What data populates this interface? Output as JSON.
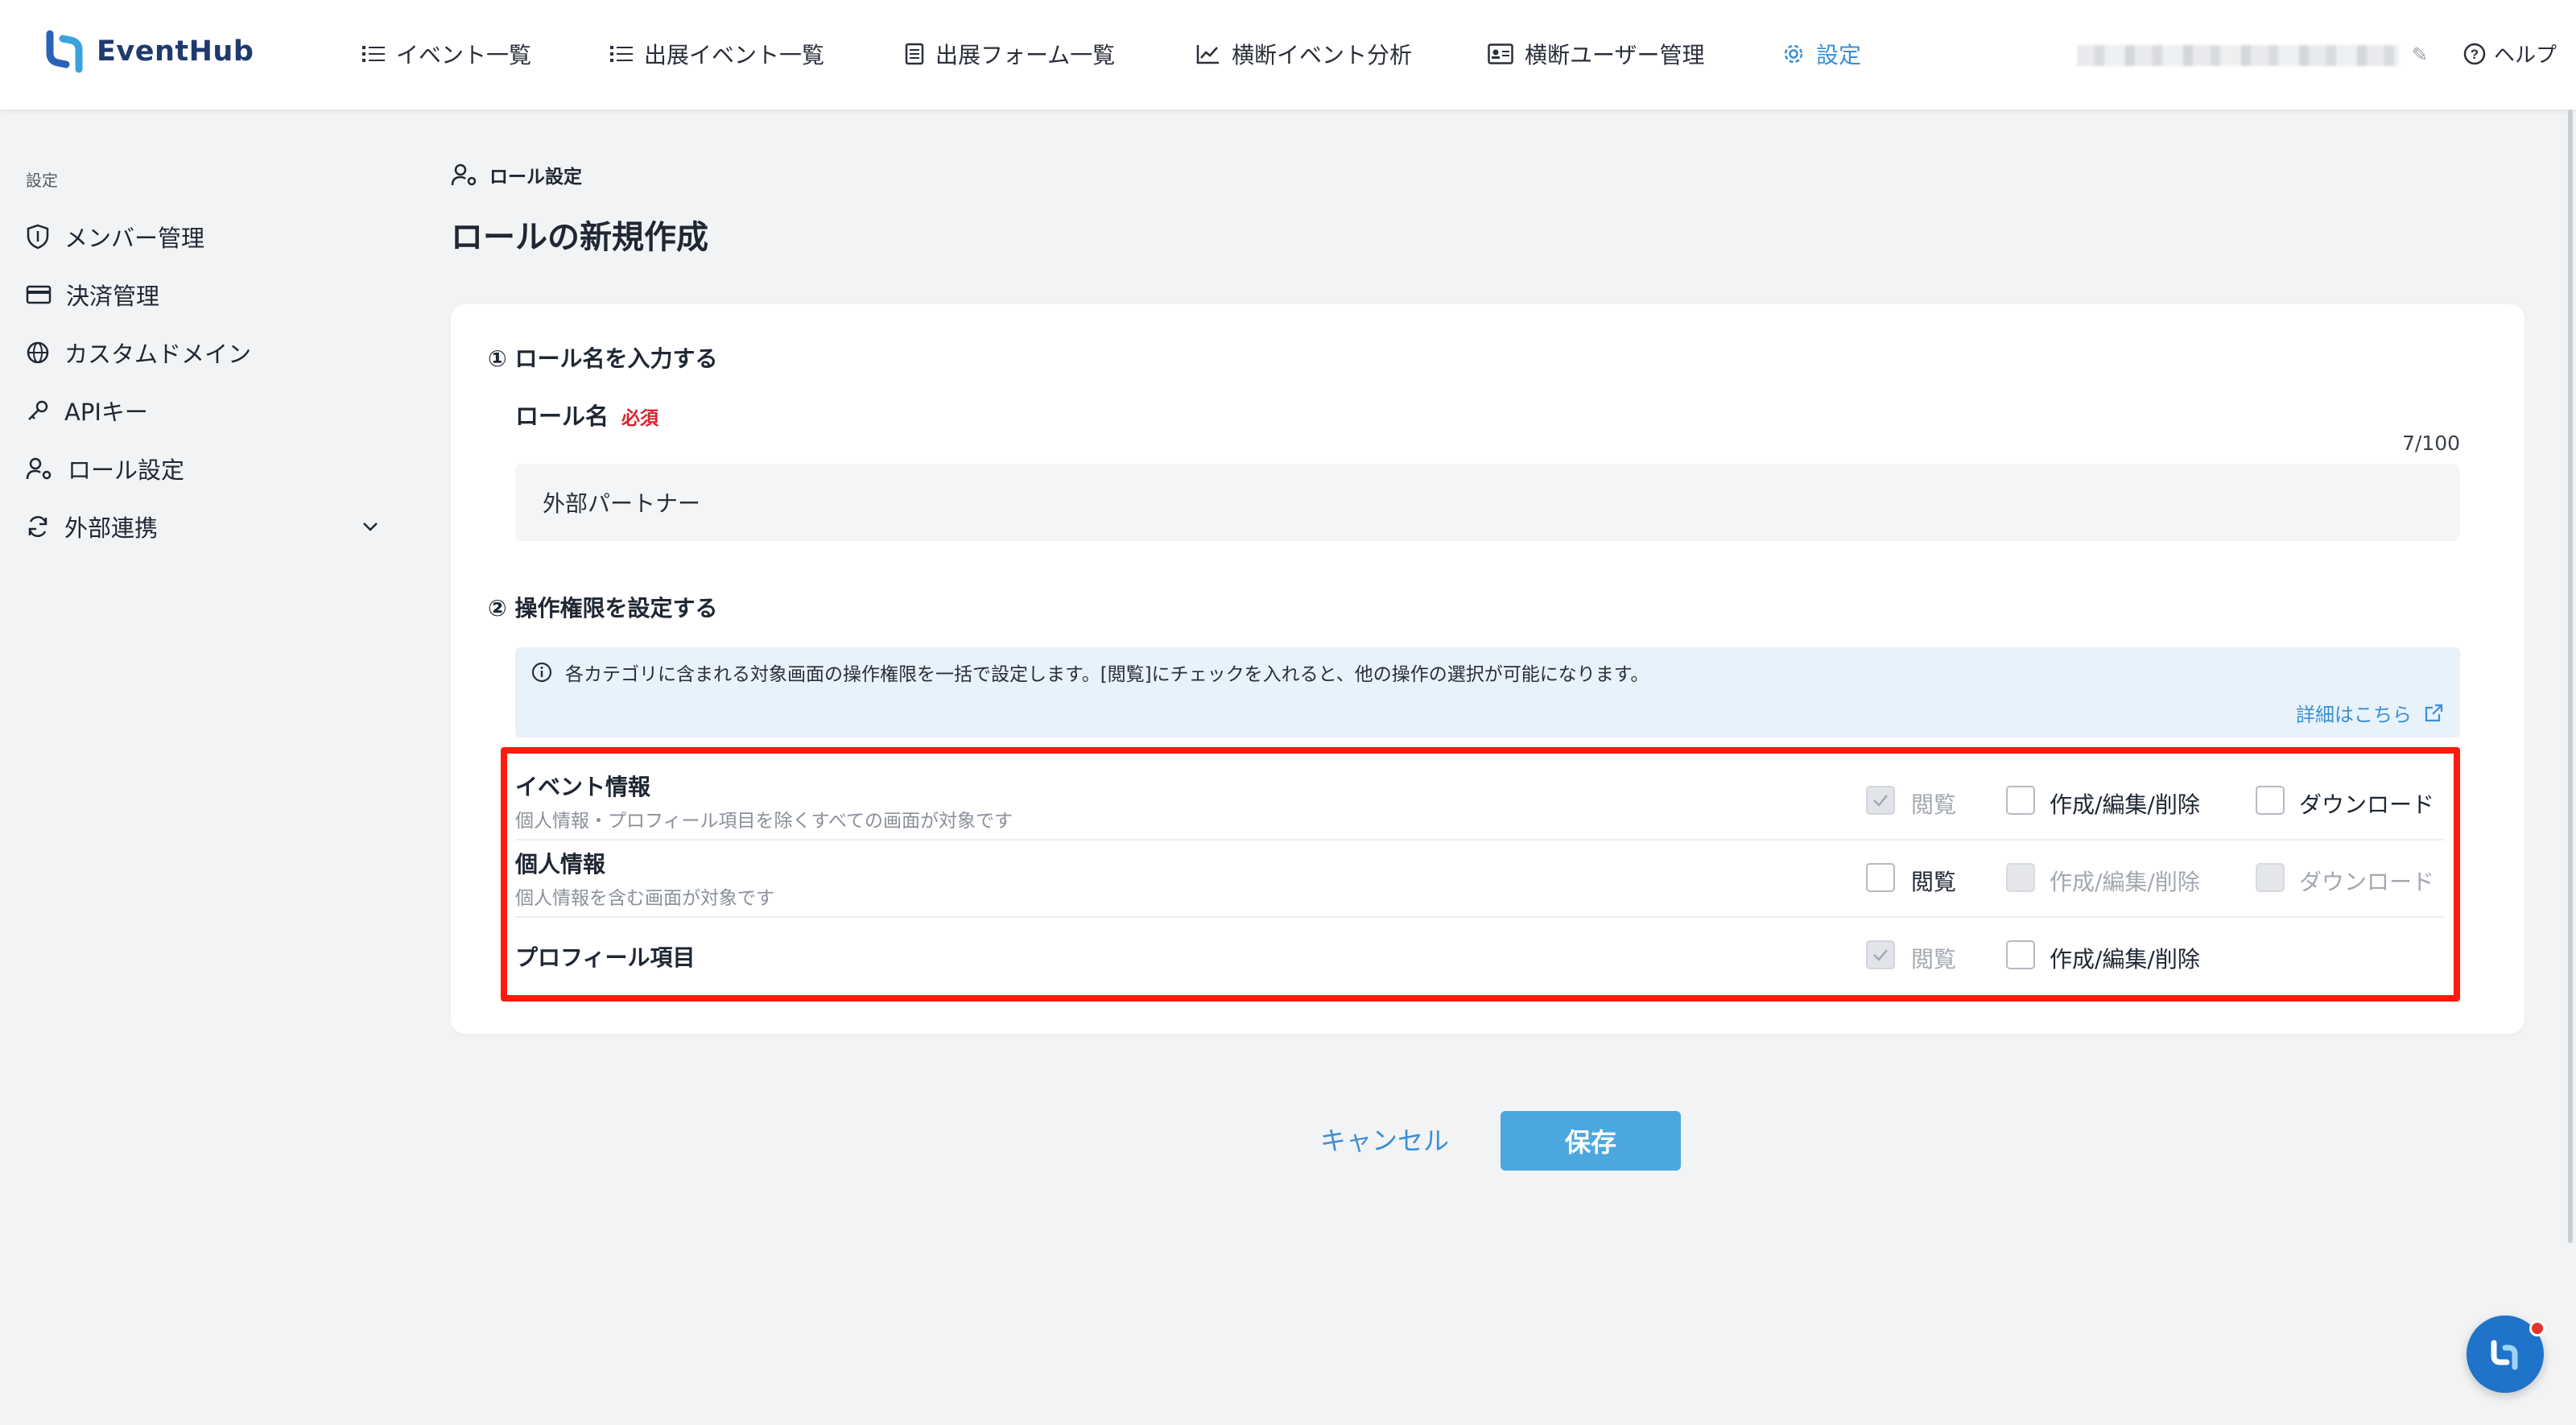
{
  "app": {
    "name": "EventHub"
  },
  "nav": [
    {
      "label": "イベント一覧",
      "icon": "list-icon"
    },
    {
      "label": "出展イベント一覧",
      "icon": "list-icon"
    },
    {
      "label": "出展フォーム一覧",
      "icon": "form-icon"
    },
    {
      "label": "横断イベント分析",
      "icon": "chart-line-icon"
    },
    {
      "label": "横断ユーザー管理",
      "icon": "id-card-icon"
    },
    {
      "label": "設定",
      "icon": "gear-icon",
      "active": true
    }
  ],
  "header": {
    "help_label": "ヘルプ"
  },
  "sidebar": {
    "heading": "設定",
    "items": [
      {
        "label": "メンバー管理",
        "icon": "shield-icon"
      },
      {
        "label": "決済管理",
        "icon": "credit-card-icon"
      },
      {
        "label": "カスタムドメイン",
        "icon": "globe-icon"
      },
      {
        "label": "APIキー",
        "icon": "key-icon"
      },
      {
        "label": "ロール設定",
        "icon": "user-gear-icon"
      },
      {
        "label": "外部連携",
        "icon": "sync-icon",
        "expandable": true
      }
    ]
  },
  "breadcrumb": {
    "label": "ロール設定"
  },
  "page": {
    "title": "ロールの新規作成"
  },
  "form": {
    "step1_title": "① ロール名を入力する",
    "role_name_label": "ロール名",
    "required_label": "必須",
    "counter": "7/100",
    "role_name_value": "外部パートナー",
    "step2_title": "② 操作権限を設定する",
    "info_text": "各カテゴリに含まれる対象画面の操作権限を一括で設定します。[閲覧]にチェックを入れると、他の操作の選択が可能になります。",
    "info_link": "詳細はこちら"
  },
  "permissions": [
    {
      "name": "イベント情報",
      "description": "個人情報・プロフィール項目を除くすべての画面が対象です",
      "view": {
        "label": "閲覧",
        "state": "checked-disabled"
      },
      "edit": {
        "label": "作成/編集/削除",
        "state": "unchecked"
      },
      "download": {
        "label": "ダウンロード",
        "state": "unchecked"
      }
    },
    {
      "name": "個人情報",
      "description": "個人情報を含む画面が対象です",
      "view": {
        "label": "閲覧",
        "state": "unchecked"
      },
      "edit": {
        "label": "作成/編集/削除",
        "state": "disabled"
      },
      "download": {
        "label": "ダウンロード",
        "state": "disabled"
      }
    },
    {
      "name": "プロフィール項目",
      "description": "",
      "view": {
        "label": "閲覧",
        "state": "checked-disabled"
      },
      "edit": {
        "label": "作成/編集/削除",
        "state": "unchecked"
      }
    }
  ],
  "actions": {
    "cancel_label": "キャンセル",
    "save_label": "保存"
  },
  "colors": {
    "accent": "#3b8fd4",
    "highlight_frame": "#ff1a0d",
    "required": "#d9232e",
    "save_button": "#4da7df"
  }
}
